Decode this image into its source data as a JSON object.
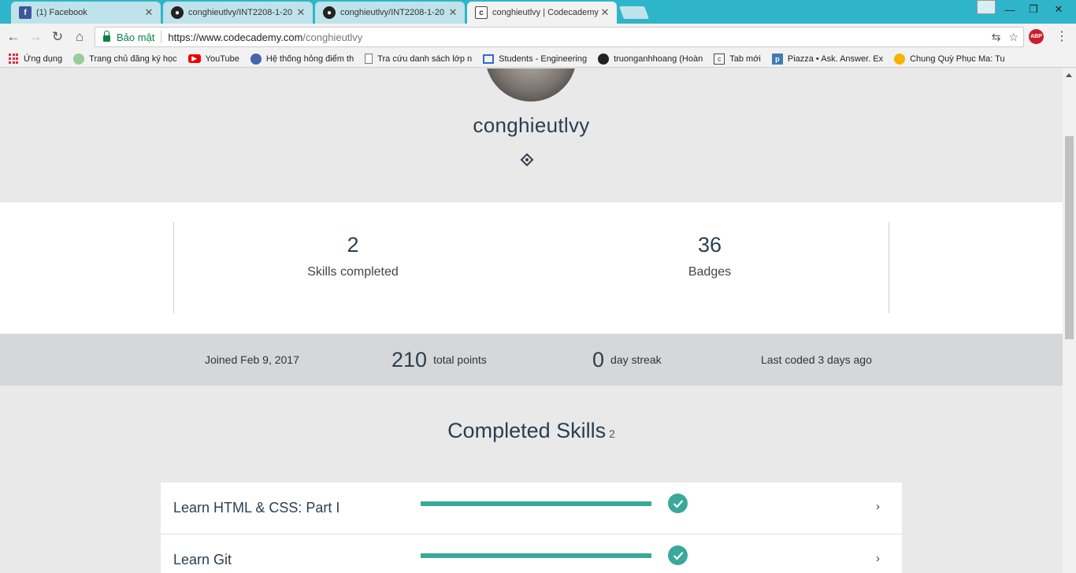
{
  "browser": {
    "tabs": [
      {
        "title": "(1) Facebook",
        "icon": "facebook-icon"
      },
      {
        "title": "conghieutlvy/INT2208-1-20",
        "icon": "github-icon"
      },
      {
        "title": "conghieutlvy/INT2208-1-20",
        "icon": "github-icon"
      },
      {
        "title": "conghieutlvy | Codecademy",
        "icon": "codecademy-icon"
      }
    ],
    "secure_label": "Bảo mật",
    "url_host": "https://www.codecademy.com",
    "url_path": "/conghieutlvy",
    "abp_label": "ABP"
  },
  "bookmarks": [
    {
      "label": "Ứng dụng",
      "icon": "apps-icon"
    },
    {
      "label": "Trang chủ đăng ký học",
      "icon": "site-icon"
    },
    {
      "label": "YouTube",
      "icon": "youtube-icon"
    },
    {
      "label": "Hệ thống hỏng điểm th",
      "icon": "globe-icon"
    },
    {
      "label": "Tra cứu danh sách lớp n",
      "icon": "document-icon"
    },
    {
      "label": "Students - Engineering",
      "icon": "table-icon"
    },
    {
      "label": "truonganhhoang (Hoàn",
      "icon": "github-icon"
    },
    {
      "label": "Tab mới",
      "icon": "codecademy-icon"
    },
    {
      "label": "Piazza • Ask. Answer. Ex",
      "icon": "piazza-icon"
    },
    {
      "label": "Chung Quỳ Phục Ma: Tu",
      "icon": "ball-icon"
    }
  ],
  "profile": {
    "username": "conghieutlvy"
  },
  "stats": {
    "skills_completed": {
      "value": "2",
      "label": "Skills completed"
    },
    "badges": {
      "value": "36",
      "label": "Badges"
    }
  },
  "meta": {
    "joined": "Joined Feb 9, 2017",
    "points_value": "210",
    "points_label": "total points",
    "streak_value": "0",
    "streak_label": "day streak",
    "last_coded": "Last coded 3 days ago"
  },
  "completed_skills": {
    "title": "Completed Skills",
    "count": "2",
    "items": [
      {
        "name": "Learn HTML & CSS: Part I",
        "progress": 1.0
      },
      {
        "name": "Learn Git",
        "progress": 1.0
      }
    ]
  },
  "colors": {
    "tabstrip": "#2fb5c9",
    "accent": "#3aa89b",
    "heading": "#2c3e50"
  }
}
